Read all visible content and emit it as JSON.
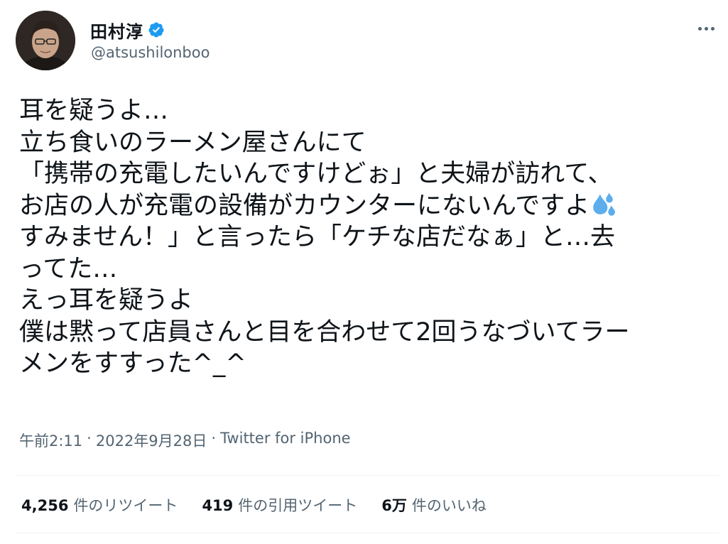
{
  "user": {
    "display_name": "田村淳",
    "handle": "@atsushilonboo",
    "verified_icon": "verified-badge-icon",
    "avatar_icon": "profile-avatar"
  },
  "tweet": {
    "lines": [
      "耳を疑うよ…",
      "立ち食いのラーメン屋さんにて",
      "「携帯の充電したいんですけどぉ」と夫婦が訪れて、",
      "お店の人が充電の設備がカウンターにないんですよ",
      "すみません！」と言ったら「ケチな店だなぁ」と…去",
      "ってた…",
      "えっ耳を疑うよ",
      "僕は黙って店員さんと目を合わせて2回うなづいてラー",
      "メンをすすった^_^"
    ],
    "emoji": "sweat-droplets-icon"
  },
  "meta": {
    "time": "午前2:11",
    "date": "2022年9月28日",
    "source": "Twitter for iPhone",
    "separator": "·"
  },
  "stats": {
    "retweets": {
      "count": "4,256",
      "label": "件のリツイート"
    },
    "quotes": {
      "count": "419",
      "label": "件の引用ツイート"
    },
    "likes": {
      "count": "6万",
      "label": "件のいいね"
    }
  },
  "colors": {
    "text": "#0f1419",
    "secondary": "#536471",
    "verified": "#1d9bf0",
    "divider": "#eff3f4"
  }
}
